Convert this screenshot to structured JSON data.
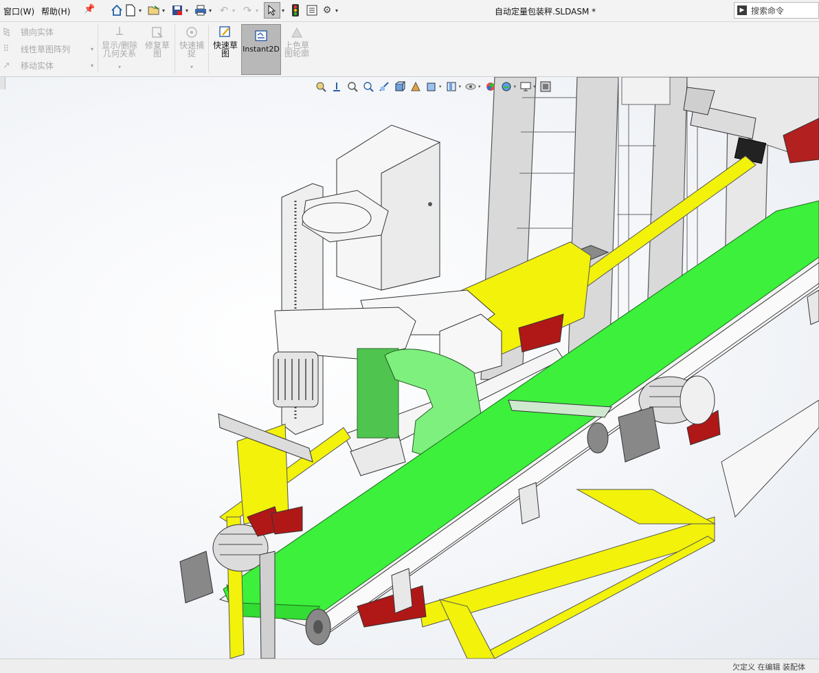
{
  "menubar": {
    "items": [
      {
        "label": "窗口(W)"
      },
      {
        "label": "帮助(H)"
      }
    ],
    "doc_title": "自动定量包装秤.SLDASM *",
    "search_placeholder": "搜索命令"
  },
  "ribbon": {
    "small_tools": [
      {
        "label": "镜向实体",
        "icon": "mirror-icon"
      },
      {
        "label": "线性草图阵列",
        "icon": "linear-pattern-icon"
      },
      {
        "label": "移动实体",
        "icon": "move-entities-icon"
      }
    ],
    "big_tools": [
      {
        "label_lines": [
          "显示/删除",
          "几何关系"
        ],
        "state": "disabled"
      },
      {
        "label_lines": [
          "修复草",
          "图"
        ],
        "state": "disabled"
      },
      {
        "label_lines": [
          "快速捕",
          "捉"
        ],
        "state": "disabled"
      },
      {
        "label_lines": [
          "快速草",
          "图"
        ],
        "state": "enabled"
      },
      {
        "label_lines": [
          "Instant2D"
        ],
        "state": "selected"
      },
      {
        "label_lines": [
          "上色草",
          "图轮廓"
        ],
        "state": "disabled"
      }
    ]
  },
  "colors": {
    "belt_green": "#3cf03c",
    "frame_yellow": "#f2f20a",
    "motor_red": "#b01818",
    "structure_gray": "#d8d8d8",
    "panel_white": "#f7f7f7"
  },
  "statusbar": {
    "left": "",
    "right": "欠定义    在编辑 装配体"
  }
}
